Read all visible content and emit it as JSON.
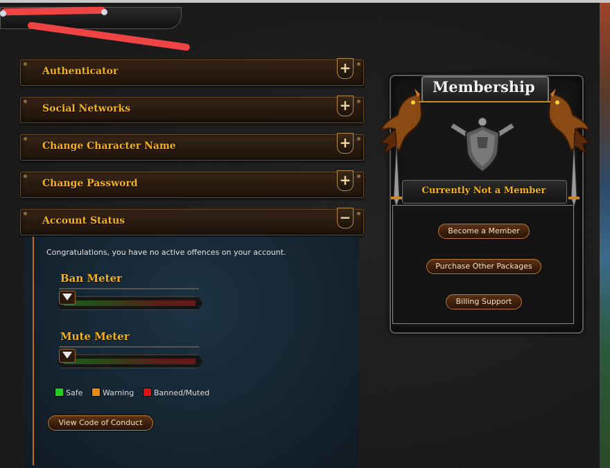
{
  "accordions": [
    {
      "title": "Authenticator",
      "toggle": "+"
    },
    {
      "title": "Social Networks",
      "toggle": "+"
    },
    {
      "title": "Change Character Name",
      "toggle": "+"
    },
    {
      "title": "Change Password",
      "toggle": "+"
    },
    {
      "title": "Account Status",
      "toggle": "−"
    }
  ],
  "account_status": {
    "message": "Congratulations, you have no active offences on your account.",
    "ban_meter": {
      "title": "Ban Meter",
      "level": 0
    },
    "mute_meter": {
      "title": "Mute Meter",
      "level": 0
    },
    "legend": [
      {
        "label": "Safe",
        "color": "#22cc22"
      },
      {
        "label": "Warning",
        "color": "#e88a10"
      },
      {
        "label": "Banned/Muted",
        "color": "#dd1111"
      }
    ],
    "conduct_button": "View Code of Conduct"
  },
  "membership": {
    "title": "Membership",
    "status": "Currently Not a Member",
    "buttons": [
      "Become a Member",
      "Purchase Other Packages",
      "Billing Support"
    ]
  },
  "colors": {
    "accent_gold": "#f2b21e",
    "redaction": "#ee4444",
    "button_border": "#c07a30"
  }
}
